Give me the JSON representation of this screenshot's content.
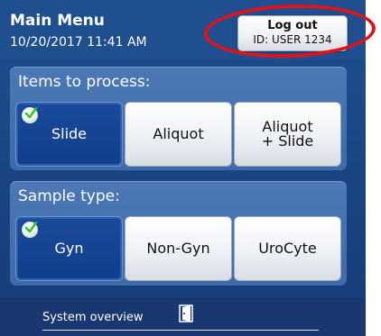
{
  "header": {
    "title": "Main Menu",
    "datetime": "10/20/2017 11:41 AM",
    "logout_label": "Log out",
    "user_id": "ID: USER 1234"
  },
  "items_panel": {
    "label": "Items to process:",
    "options": [
      {
        "label": "Slide",
        "selected": true
      },
      {
        "label": "Aliquot",
        "selected": false
      },
      {
        "label_line1": "Aliquot",
        "label_line2": "+ Slide",
        "selected": false
      }
    ]
  },
  "sample_panel": {
    "label": "Sample type:",
    "options": [
      {
        "label": "Gyn",
        "selected": true
      },
      {
        "label": "Non-Gyn",
        "selected": false
      },
      {
        "label": "UroCyte",
        "selected": false
      }
    ]
  },
  "footer": {
    "label": "System overview",
    "icon": "door-icon"
  },
  "colors": {
    "background": "#1f4f8f",
    "panel": "#4c78b6",
    "selected": "#123e8a",
    "annotation": "#e0131a",
    "check": "#2fbf2f"
  }
}
